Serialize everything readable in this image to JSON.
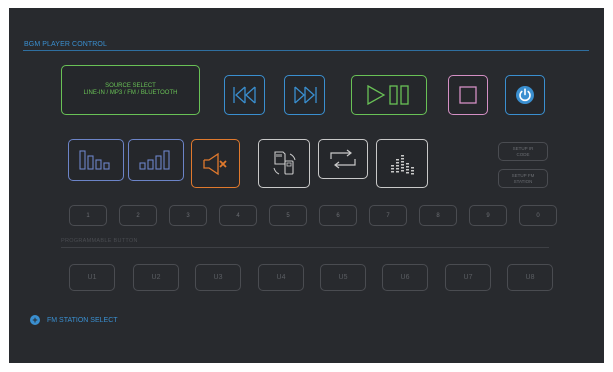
{
  "header": {
    "title": "BGM PLAYER CONTROL"
  },
  "source_select": {
    "line1": "SOURCE SELECT",
    "line2": "LINE-IN / MP3 / FM / BLUETOOTH"
  },
  "controls": {
    "prev_icon": "skip-back-icon",
    "next_icon": "skip-forward-icon",
    "play_pause_icon": "play-pause-icon",
    "stop_icon": "stop-icon",
    "power_icon": "power-icon",
    "volume_down_icon": "volume-down-icon",
    "volume_up_icon": "volume-up-icon",
    "mute_icon": "mute-icon",
    "media_icon": "sd-usb-icon",
    "repeat_icon": "repeat-icon",
    "eq_icon": "equalizer-icon"
  },
  "setup": {
    "ir_line1": "SETUP IR",
    "ir_line2": "CODE",
    "fm_line1": "SETUP FM",
    "fm_line2": "STATION"
  },
  "numbers": [
    "1",
    "2",
    "3",
    "4",
    "5",
    "6",
    "7",
    "8",
    "9",
    "0"
  ],
  "programmable": {
    "label": "PROGRAMMABLE BUTTON",
    "buttons": [
      "U1",
      "U2",
      "U3",
      "U4",
      "U5",
      "U6",
      "U7",
      "U8"
    ]
  },
  "fm_station": {
    "label": "FM STATION SELECT"
  },
  "colors": {
    "blue": "#3a8fd0",
    "green": "#69c156",
    "pink": "#d48fc4",
    "orange": "#e0792d",
    "slate": "#6c84c8",
    "panel": "#282a2e"
  }
}
